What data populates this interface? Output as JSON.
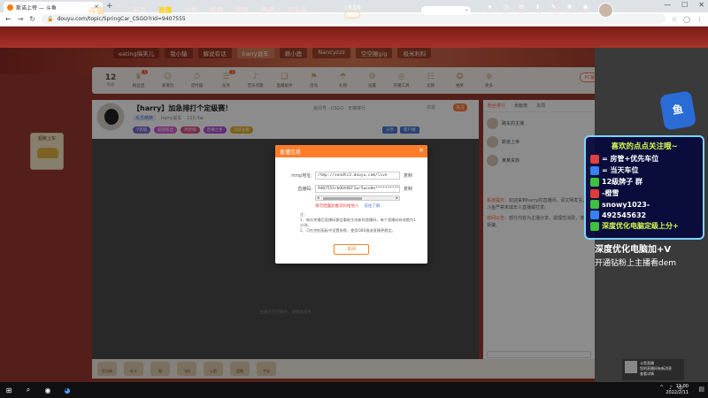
{
  "browser": {
    "tab_title": "斯诺上帝 — 斗鱼",
    "url": "douyu.com/topic/SpringCar_CSGO?rid=9407555",
    "new_tab": "+",
    "min": "—",
    "max": "☐",
    "close": "✕"
  },
  "site": {
    "logo": "斗鱼",
    "nav": [
      "首页",
      "直播",
      "分类",
      "视频",
      "游戏",
      "鱼吧",
      "元宇宙"
    ],
    "active_nav": "直播",
    "center_line1": "斗鱼直播",
    "center_pill": "Pro",
    "search_placeholder": "",
    "header_icons": [
      {
        "icon": "★",
        "label": "关注"
      },
      {
        "icon": "◷",
        "label": "历史"
      },
      {
        "icon": "✉",
        "label": "消息"
      },
      {
        "icon": "⬇",
        "label": "下载"
      },
      {
        "icon": "✎",
        "label": "开播"
      },
      {
        "icon": "❖",
        "label": "鱼吧"
      },
      {
        "icon": "◉",
        "label": "创作"
      }
    ]
  },
  "categories": [
    "eating搞笑儿",
    "我小猿",
    "解说有话",
    "harry说车",
    "赖小鹿",
    "Nancyzzz",
    "空空圈gig",
    "极米利科"
  ],
  "selected_category": "harry说车",
  "toolbar": {
    "level": "12",
    "level_unit": "等级",
    "items": [
      {
        "icon": "♛",
        "label": "粉丝团",
        "badge": "5"
      },
      {
        "icon": "☺",
        "label": "表情包",
        "badge": ""
      },
      {
        "icon": "⏱",
        "label": "定时器",
        "badge": ""
      },
      {
        "icon": "☰",
        "label": "任务",
        "badge": "2"
      },
      {
        "icon": "♪",
        "label": "音乐点歌",
        "badge": ""
      },
      {
        "icon": "❏",
        "label": "直播助手",
        "badge": ""
      },
      {
        "icon": "⚑",
        "label": "活动",
        "badge": ""
      },
      {
        "icon": "☂",
        "label": "礼物",
        "badge": ""
      },
      {
        "icon": "⚙",
        "label": "设置",
        "badge": ""
      },
      {
        "icon": "◎",
        "label": "开播工具",
        "badge": ""
      },
      {
        "icon": "☷",
        "label": "竞猜",
        "badge": ""
      },
      {
        "icon": "✪",
        "label": "抽奖",
        "badge": ""
      },
      {
        "icon": "⊕",
        "label": "更多",
        "badge": ""
      }
    ],
    "pc_button": "PC客户端"
  },
  "room": {
    "title": "【harry】加急排打个定级赛！",
    "meta1": "房间号 · CSGO · 天梯排行",
    "report": "举报",
    "follow": "关注",
    "category": "反恐精英",
    "owner": "harry说车",
    "viewers": "110.9w",
    "badges": [
      {
        "text": "V等级",
        "color": "#7a69d8"
      },
      {
        "text": "超级粉丝",
        "color": "#d85ad8"
      },
      {
        "text": "周星榜",
        "color": "#e04c8a"
      },
      {
        "text": "直播之星",
        "color": "#b24cd8"
      },
      {
        "text": "活跃主播",
        "color": "#e0b020"
      }
    ],
    "badges_right": [
      "分享",
      "客户端"
    ],
    "video_tip": "主播正在开播中，请稍后再来"
  },
  "left_widget": {
    "title": "超跑上车"
  },
  "chat": {
    "tabs": [
      "粉丝排行",
      "贡献榜",
      "本周"
    ],
    "active_tab": "粉丝排行",
    "ranks": [
      "路车的主播",
      "斯诺上帝",
      "某某贵族"
    ],
    "messages": [
      {
        "user": "系统提示：",
        "text": "欢迎来到harry的直播间，请文明发言，斗鱼严禁未成年人直播或打赏。"
      },
      {
        "user": "房间公告：",
        "text": "部分内容为主播分享，需理性消费，谨防受骗。"
      }
    ]
  },
  "promo": {
    "title": "喜欢的点点关注哦~",
    "lines": [
      {
        "text": "= 房管+优先车位",
        "icon_color": "#e04040"
      },
      {
        "text": "= 当天车位",
        "icon_color": "#3a80f0"
      },
      {
        "text": "12级牌子 群",
        "icon_color": "#40c040"
      },
      {
        "text": "-橙雪",
        "icon_color": "#e03a3a"
      },
      {
        "text": "snowy1023-",
        "icon_color": "#40c040"
      },
      {
        "text": "492545632",
        "icon_color": "#3a80f0"
      },
      {
        "text": "深度优化电脑定级上分+",
        "icon_color": "#40c040",
        "yellow": true
      }
    ],
    "bottom1": "深度优化电脑加+V",
    "bottom2": "开通钻粉上主播看dem"
  },
  "gifts": [
    "荧光棒",
    "办卡",
    "稳",
    "飞机",
    "火箭",
    "超跑",
    "宇宙"
  ],
  "modal": {
    "title": "直播信息",
    "close": "✕",
    "rtmp_label": "rtmp地址:",
    "rtmp_value": "rtmp://sendtc3.douyu.com/live",
    "stream_label": "直播码:",
    "stream_value": "9407555rbOOtDEFIwr5wcoHe**********",
    "copy": "复制",
    "warning": "请勿泄露此推流码给他人",
    "link": "前往了解",
    "notes": [
      "注：",
      "1、每次关播后直播码都会重新生成新的直播码，每个直播码有效期为1分钟。",
      "2、可在控制面板中设置参数，使用OBS推流直播更稳定。"
    ],
    "ok": "关闭"
  },
  "toast": {
    "line1": "斗鱼直播",
    "line2": "您的直播间有新消息",
    "line3": "查看详情"
  },
  "taskbar": {
    "time": "11:00",
    "date": "2022/2/11",
    "tray": [
      "^",
      "♪",
      "中"
    ]
  }
}
